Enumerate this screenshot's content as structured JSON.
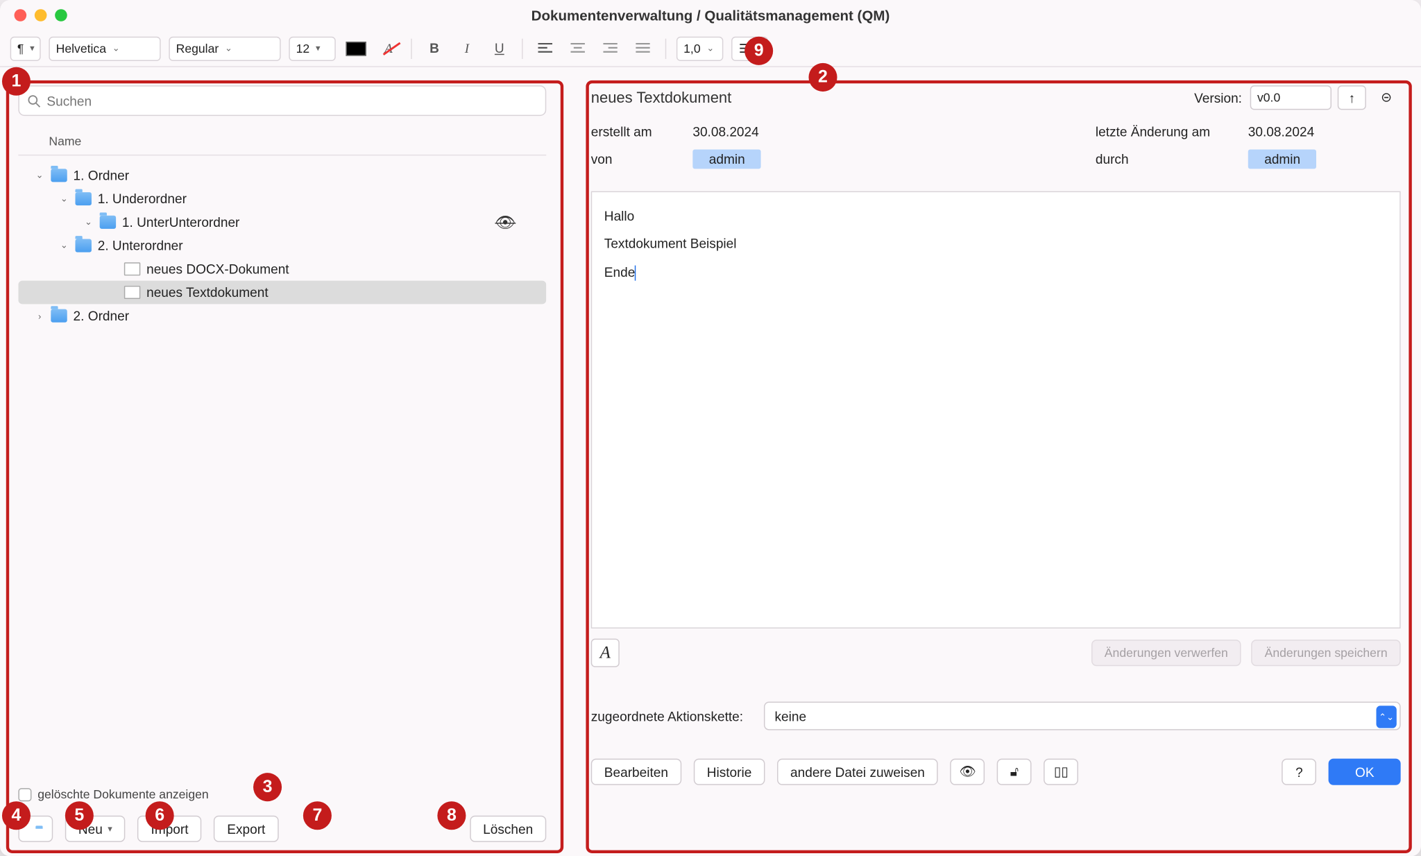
{
  "window_title": "Dokumentenverwaltung / Qualitätsmanagement (QM)",
  "toolbar": {
    "para_style": "¶",
    "font_family": "Helvetica",
    "font_style": "Regular",
    "font_size": "12",
    "line_spacing": "1,0"
  },
  "badges": [
    "1",
    "2",
    "3",
    "4",
    "5",
    "6",
    "7",
    "8",
    "9"
  ],
  "left": {
    "search_placeholder": "Suchen",
    "column_header": "Name",
    "tree": [
      {
        "label": "1. Ordner",
        "indent": 0,
        "kind": "folder",
        "expanded": true
      },
      {
        "label": "1. Underordner",
        "indent": 1,
        "kind": "folder",
        "expanded": true
      },
      {
        "label": "1. UnterUnterordner",
        "indent": 2,
        "kind": "folder",
        "expanded": true,
        "hidden_badge": true
      },
      {
        "label": "2. Unterordner",
        "indent": 1,
        "kind": "folder",
        "expanded": true
      },
      {
        "label": "neues DOCX-Dokument",
        "indent": 3,
        "kind": "file"
      },
      {
        "label": "neues Textdokument",
        "indent": 3,
        "kind": "file",
        "selected": true
      },
      {
        "label": "2. Ordner",
        "indent": 0,
        "kind": "folder",
        "expanded": false
      }
    ],
    "show_deleted_label": "gelöschte Dokumente anzeigen",
    "btn_new": "Neu",
    "btn_import": "Import",
    "btn_export": "Export",
    "btn_delete": "Löschen"
  },
  "right": {
    "doc_title": "neues Textdokument",
    "version_label": "Version:",
    "version_value": "v0.0",
    "created_label": "erstellt am",
    "created_value": "30.08.2024",
    "created_by_label": "von",
    "created_by_value": "admin",
    "modified_label": "letzte Änderung am",
    "modified_value": "30.08.2024",
    "modified_by_label": "durch",
    "modified_by_value": "admin",
    "editor_lines": [
      "Hallo",
      "Textdokument Beispiel",
      "Ende"
    ],
    "discard_label": "Änderungen verwerfen",
    "save_label": "Änderungen speichern",
    "chain_label": "zugeordnete Aktionskette:",
    "chain_value": "keine",
    "btn_edit": "Bearbeiten",
    "btn_history": "Historie",
    "btn_assign": "andere Datei zuweisen",
    "btn_ok": "OK",
    "btn_help": "?"
  }
}
